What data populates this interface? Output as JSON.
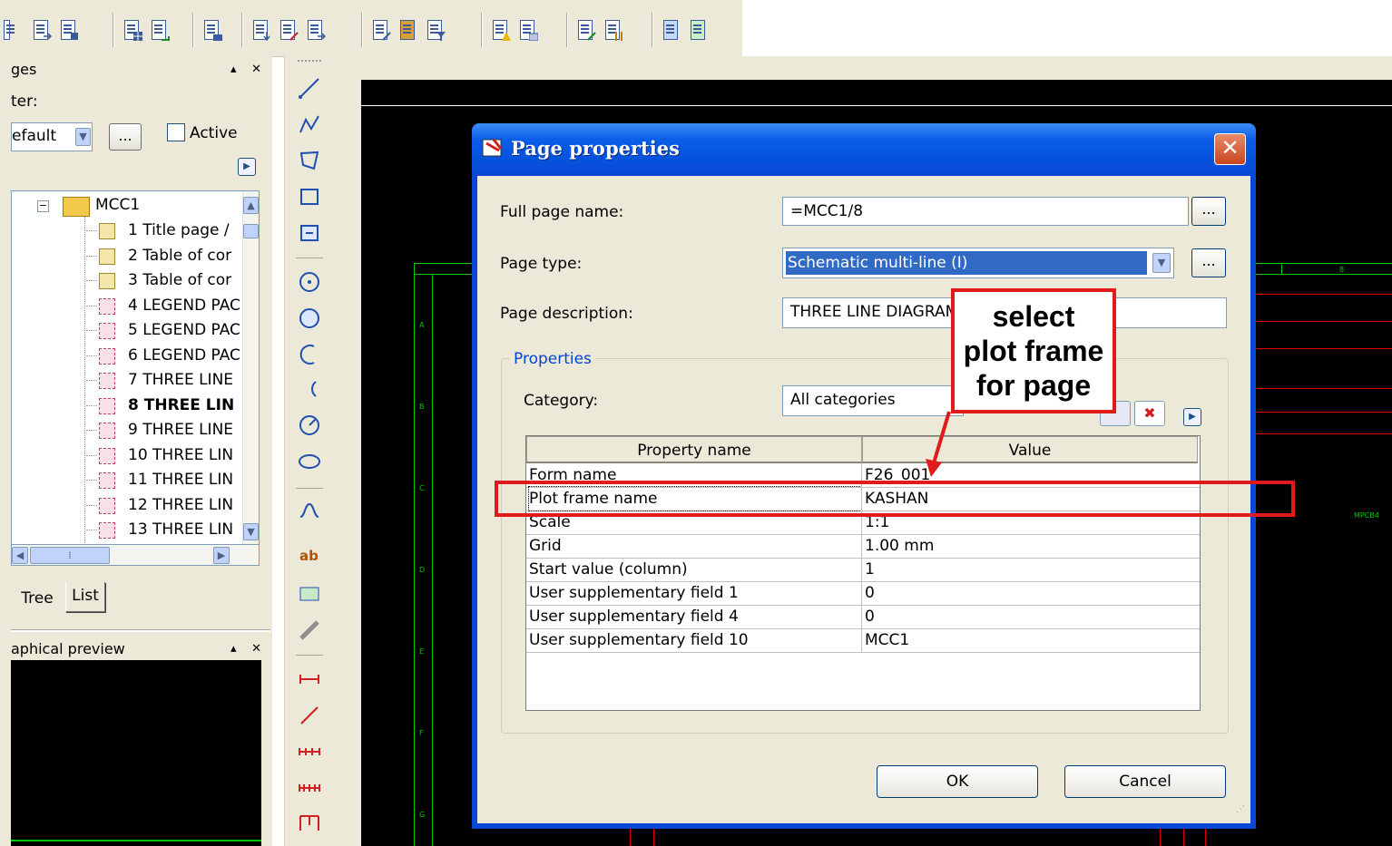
{
  "left_panel": {
    "pages_header": "ges",
    "filter_label": "ter:",
    "filter_value": "efault",
    "filter_dots": "...",
    "active_label": "Active",
    "tree_root": "MCC1",
    "tree_items": [
      {
        "label": "1 Title page /",
        "bold": false,
        "kind": "table"
      },
      {
        "label": "2 Table of cor",
        "bold": false,
        "kind": "table"
      },
      {
        "label": "3 Table of cor",
        "bold": false,
        "kind": "table"
      },
      {
        "label": "4 LEGEND PAC",
        "bold": false,
        "kind": "schematic"
      },
      {
        "label": "5 LEGEND PAC",
        "bold": false,
        "kind": "schematic"
      },
      {
        "label": "6 LEGEND PAC",
        "bold": false,
        "kind": "schematic"
      },
      {
        "label": "7 THREE LINE",
        "bold": false,
        "kind": "schematic"
      },
      {
        "label": "8 THREE LIN",
        "bold": true,
        "kind": "schematic"
      },
      {
        "label": "9 THREE LINE",
        "bold": false,
        "kind": "schematic"
      },
      {
        "label": "10 THREE LIN",
        "bold": false,
        "kind": "schematic"
      },
      {
        "label": "11 THREE LIN",
        "bold": false,
        "kind": "schematic"
      },
      {
        "label": "12 THREE LIN",
        "bold": false,
        "kind": "schematic"
      },
      {
        "label": "13 THREE LIN",
        "bold": false,
        "kind": "schematic"
      }
    ],
    "tab_tree": "Tree",
    "tab_list": "List",
    "preview_header": "aphical preview"
  },
  "canvas": {
    "row_letters": [
      "A",
      "B",
      "C",
      "D",
      "E",
      "F",
      "G"
    ],
    "column_marker": "8",
    "side_label": "MPCB4"
  },
  "dialog": {
    "title": "Page properties",
    "close_glyph": "✕",
    "full_page_name_label": "Full page name:",
    "full_page_name_value": "=MCC1/8",
    "page_type_label": "Page type:",
    "page_type_value": "Schematic multi-line (I)",
    "page_description_label": "Page description:",
    "page_description_value": "THREE LINE DIAGRAM",
    "dots": "...",
    "properties_group": "Properties",
    "category_label": "Category:",
    "category_value": "All categories",
    "table_headers": [
      "Property name",
      "Value"
    ],
    "table_rows": [
      {
        "name": "Form name",
        "value": "F26_001"
      },
      {
        "name": "Plot frame name",
        "value": "KASHAN"
      },
      {
        "name": "Scale",
        "value": "1:1"
      },
      {
        "name": "Grid",
        "value": "1.00 mm"
      },
      {
        "name": "Start value (column)",
        "value": "1"
      },
      {
        "name": "User supplementary field 1",
        "value": "0"
      },
      {
        "name": "User supplementary field 4",
        "value": "0"
      },
      {
        "name": "User supplementary field 10",
        "value": "MCC1"
      }
    ],
    "ok_label": "OK",
    "cancel_label": "Cancel"
  },
  "annotation": {
    "callout_lines": [
      "select",
      "plot frame",
      "for page"
    ],
    "callout_color": "#e11b1b"
  },
  "colors": {
    "titlebar": "#0a5ee8",
    "selection": "#316ac5",
    "drawing_background": "#000000",
    "drawing_lines_green": "#00c800",
    "drawing_lines_red": "#e00000"
  }
}
